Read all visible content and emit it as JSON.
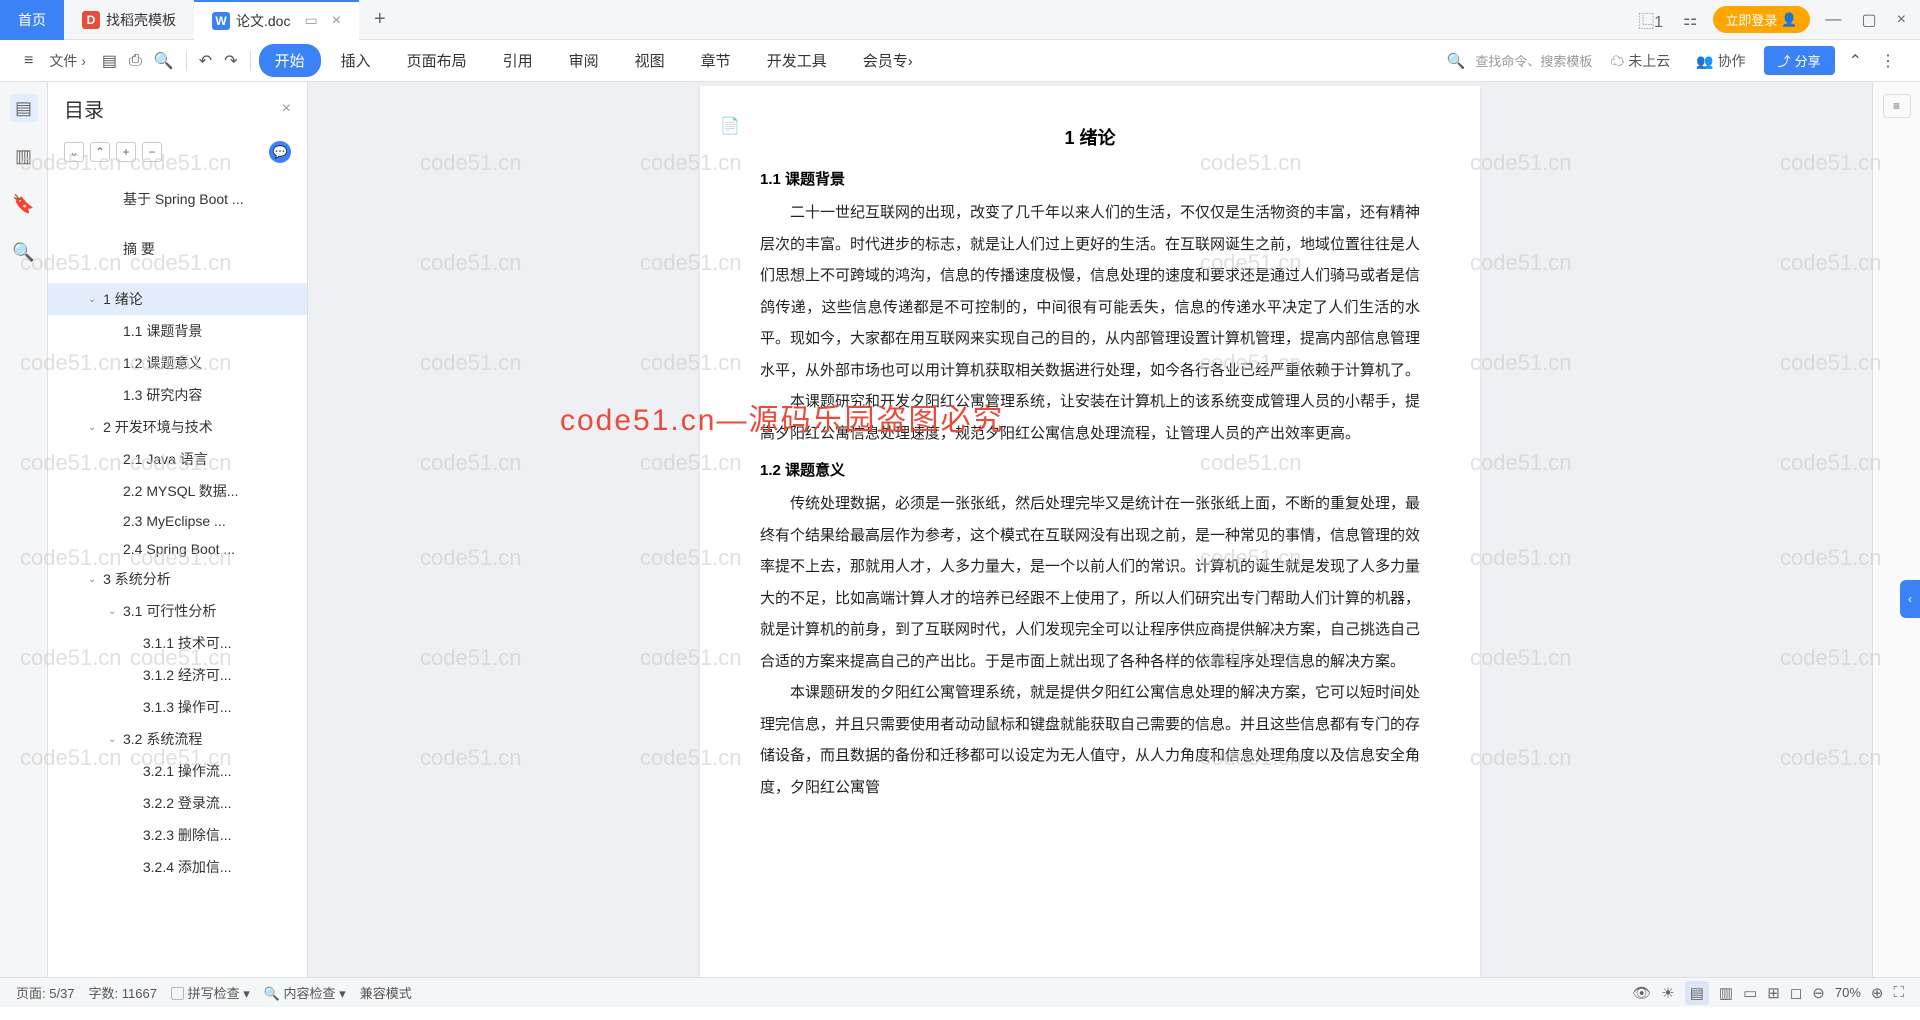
{
  "tabs": {
    "home": "首页",
    "template": "找稻壳模板",
    "doc": "论文.doc"
  },
  "titleRight": {
    "login": "立即登录"
  },
  "ribbon": {
    "file": "文件",
    "menus": [
      "开始",
      "插入",
      "页面布局",
      "引用",
      "审阅",
      "视图",
      "章节",
      "开发工具",
      "会员专"
    ],
    "search": "查找命令、搜索模板",
    "cloud": "未上云",
    "collab": "协作",
    "share": "分享"
  },
  "toc": {
    "title": "目录",
    "items": [
      {
        "text": "基于 Spring Boot ...",
        "indent": 1,
        "chevron": ""
      },
      {
        "text": "摘   要",
        "indent": 1,
        "chevron": ""
      },
      {
        "text": "1  绪论",
        "indent": 0,
        "chevron": "›",
        "selected": true
      },
      {
        "text": "1.1 课题背景",
        "indent": 1,
        "chevron": ""
      },
      {
        "text": "1.2 课题意义",
        "indent": 1,
        "chevron": ""
      },
      {
        "text": "1.3 研究内容",
        "indent": 1,
        "chevron": ""
      },
      {
        "text": "2  开发环境与技术",
        "indent": 0,
        "chevron": "›"
      },
      {
        "text": "2.1 Java 语言",
        "indent": 1,
        "chevron": ""
      },
      {
        "text": "2.2 MYSQL 数据...",
        "indent": 1,
        "chevron": ""
      },
      {
        "text": "2.3 MyEclipse ...",
        "indent": 1,
        "chevron": ""
      },
      {
        "text": "2.4 Spring Boot ...",
        "indent": 1,
        "chevron": ""
      },
      {
        "text": "3  系统分析",
        "indent": 0,
        "chevron": "›"
      },
      {
        "text": "3.1 可行性分析",
        "indent": 1,
        "chevron": "›"
      },
      {
        "text": "3.1.1  技术可...",
        "indent": 2,
        "chevron": ""
      },
      {
        "text": "3.1.2  经济可...",
        "indent": 2,
        "chevron": ""
      },
      {
        "text": "3.1.3  操作可...",
        "indent": 2,
        "chevron": ""
      },
      {
        "text": "3.2  系统流程",
        "indent": 1,
        "chevron": "›"
      },
      {
        "text": "3.2.1  操作流...",
        "indent": 2,
        "chevron": ""
      },
      {
        "text": "3.2.2  登录流...",
        "indent": 2,
        "chevron": ""
      },
      {
        "text": "3.2.3  删除信...",
        "indent": 2,
        "chevron": ""
      },
      {
        "text": "3.2.4  添加信...",
        "indent": 2,
        "chevron": ""
      }
    ]
  },
  "doc": {
    "chapter": "1  绪论",
    "s1": "1.1 课题背景",
    "p1": "二十一世纪互联网的出现，改变了几千年以来人们的生活，不仅仅是生活物资的丰富，还有精神层次的丰富。时代进步的标志，就是让人们过上更好的生活。在互联网诞生之前，地域位置往往是人们思想上不可跨域的鸿沟，信息的传播速度极慢，信息处理的速度和要求还是通过人们骑马或者是信鸽传递，这些信息传递都是不可控制的，中间很有可能丢失，信息的传递水平决定了人们生活的水平。现如今，大家都在用互联网来实现自己的目的，从内部管理设置计算机管理，提高内部信息管理水平，从外部市场也可以用计算机获取相关数据进行处理，如今各行各业已经严重依赖于计算机了。",
    "p2": "本课题研究和开发夕阳红公寓管理系统，让安装在计算机上的该系统变成管理人员的小帮手，提高夕阳红公寓信息处理速度，规范夕阳红公寓信息处理流程，让管理人员的产出效率更高。",
    "s2": "1.2 课题意义",
    "p3": "传统处理数据，必须是一张张纸，然后处理完毕又是统计在一张张纸上面，不断的重复处理，最终有个结果给最高层作为参考，这个模式在互联网没有出现之前，是一种常见的事情，信息管理的效率提不上去，那就用人才，人多力量大，是一个以前人们的常识。计算机的诞生就是发现了人多力量大的不足，比如高端计算人才的培养已经跟不上使用了，所以人们研究出专门帮助人们计算的机器，就是计算机的前身，到了互联网时代，人们发现完全可以让程序供应商提供解决方案，自己挑选自己合适的方案来提高自己的产出比。于是市面上就出现了各种各样的依靠程序处理信息的解决方案。",
    "p4": "本课题研发的夕阳红公寓管理系统，就是提供夕阳红公寓信息处理的解决方案，它可以短时间处理完信息，并且只需要使用者动动鼠标和键盘就能获取自己需要的信息。并且这些信息都有专门的存储设备，而且数据的备份和迁移都可以设定为无人值守，从人力角度和信息处理角度以及信息安全角度，夕阳红公寓管"
  },
  "watermarkText": "code51.cn",
  "watermarkRed": "code51.cn—源码乐园盗图必究",
  "status": {
    "page": "页面: 5/37",
    "words": "字数: 11667",
    "spell": "拼写检查",
    "content": "内容检查",
    "compat": "兼容模式",
    "zoom": "70%"
  }
}
